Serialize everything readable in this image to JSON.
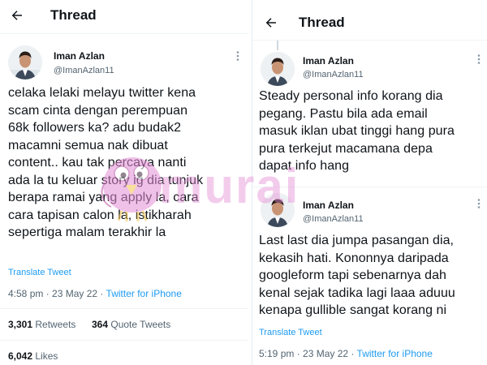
{
  "left": {
    "header": {
      "title": "Thread"
    },
    "tweet": {
      "author_name": "Iman Azlan",
      "author_handle": "@ImanAzlan11",
      "text_lines": [
        "celaka lelaki melayu twitter kena",
        "scam cinta dengan perempuan",
        "68k followers ka? adu budak2",
        "macamni semua nak dibuat",
        "content.. kau tak percaya nanti",
        "ada la tu keluar story ig dia tunjuk",
        "berapa ramai yang apply la, cara",
        "cara tapisan calon la, istikharah",
        "sepertiga malam terakhir la"
      ],
      "translate_label": "Translate Tweet",
      "time": "4:58 pm",
      "date": "23 May 22",
      "source": "Twitter for iPhone",
      "retweets": {
        "count": "3,301",
        "label": "Retweets"
      },
      "quotes": {
        "count": "364",
        "label": "Quote Tweets"
      },
      "likes": {
        "count": "6,042",
        "label": "Likes"
      }
    }
  },
  "right": {
    "header": {
      "title": "Thread"
    },
    "tweet1": {
      "author_name": "Iman Azlan",
      "author_handle": "@ImanAzlan11",
      "text_lines": [
        "Steady personal info korang dia",
        "pegang. Pastu bila ada email",
        "masuk iklan ubat tinggi hang pura",
        "pura terkejut macamana depa",
        "dapat info hang"
      ]
    },
    "tweet2": {
      "author_name": "Iman Azlan",
      "author_handle": "@ImanAzlan11",
      "text_lines": [
        "Last last dia jumpa pasangan dia,",
        "kekasih hati. Kononnya daripada",
        "googleform tapi sebenarnya dah",
        "kenal sejak tadika lagi laaa aduuu",
        "kenapa gullible sangat korang ni"
      ],
      "translate_label": "Translate Tweet",
      "time": "5:19 pm",
      "date": "23 May 22",
      "source": "Twitter for iPhone"
    }
  },
  "watermark": {
    "text": "murai"
  },
  "colors": {
    "link": "#1d9bf0",
    "secondary_text": "#536471",
    "watermark": "#e58fd6"
  },
  "icons": [
    "back-arrow-icon",
    "more-options-icon",
    "avatar"
  ]
}
